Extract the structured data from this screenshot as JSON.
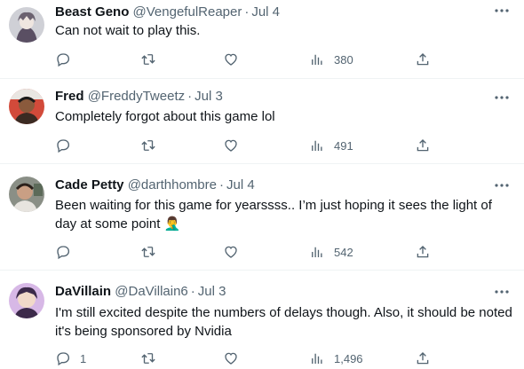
{
  "tweets": [
    {
      "display_name": "Beast Geno",
      "handle": "@VengefulReaper",
      "dot": "·",
      "time": "Jul 4",
      "text": "Can not wait to play this.",
      "replies": "",
      "views": "380",
      "avatar_icon": "anime-character-avatar",
      "avatar_colors": [
        "#cfd0d6",
        "#5a4f63"
      ]
    },
    {
      "display_name": "Fred",
      "handle": "@FreddyTweetz",
      "dot": "·",
      "time": "Jul 3",
      "text": "Completely forgot about this game lol",
      "replies": "",
      "views": "491",
      "avatar_icon": "person-photo-avatar",
      "avatar_colors": [
        "#d24a3a",
        "#3b2a22"
      ]
    },
    {
      "display_name": "Cade Petty",
      "handle": "@darthhombre",
      "dot": "·",
      "time": "Jul 4",
      "text": "Been waiting for this game for yearssss.. I’m just hoping it sees the light of day at some point 🤦‍♂️",
      "replies": "",
      "views": "542",
      "avatar_icon": "person-photo-avatar",
      "avatar_colors": [
        "#8a8f86",
        "#e7e4df"
      ]
    },
    {
      "display_name": "DaVillain",
      "handle": "@DaVillain6",
      "dot": "·",
      "time": "Jul 3",
      "text": "I'm still excited despite the numbers of delays though. Also, it should be noted it's being sponsored by Nvidia",
      "replies": "1",
      "views": "1,496",
      "avatar_icon": "illustrated-character-avatar",
      "avatar_colors": [
        "#d7b8e6",
        "#3c2a4a"
      ]
    }
  ],
  "colors": {
    "text_primary": "#0f1419",
    "text_secondary": "#536471",
    "divider": "#eff3f4"
  },
  "icons": {
    "more": "more-icon",
    "reply": "reply-icon",
    "retweet": "retweet-icon",
    "like": "like-icon",
    "views": "views-icon",
    "share": "share-icon"
  }
}
